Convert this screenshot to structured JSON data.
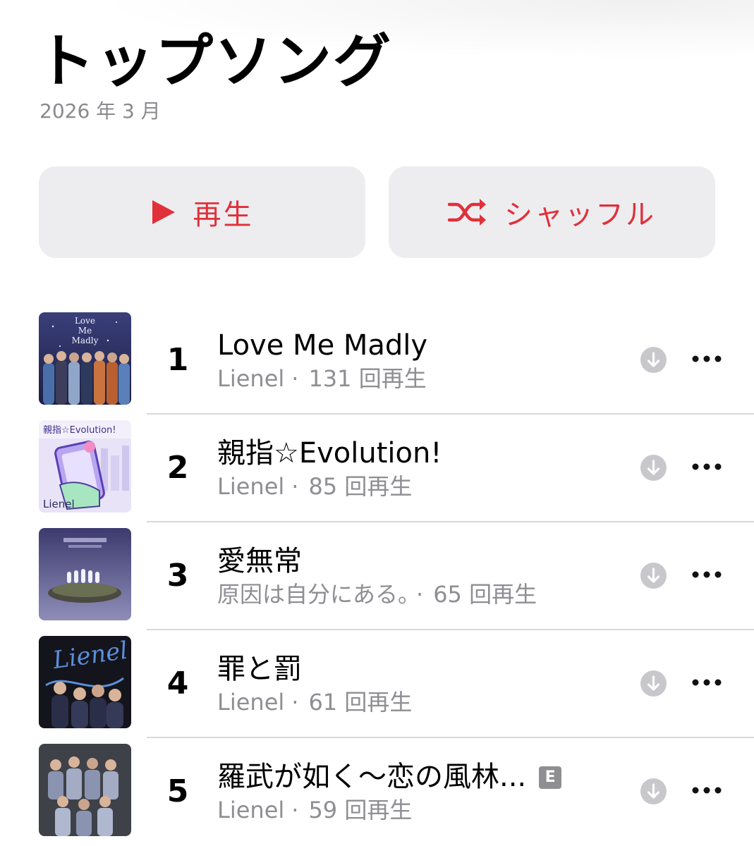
{
  "header": {
    "title": "トップソング",
    "subtitle": "2026 年 3 月"
  },
  "actions": {
    "play_label": "再生",
    "shuffle_label": "シャッフル",
    "accent_color": "#e0303a"
  },
  "songs": [
    {
      "rank": "1",
      "title": "Love Me Madly",
      "artist": "Lienel",
      "plays": "131 回再生",
      "explicit": false,
      "artwork_text": "Love Me Madly"
    },
    {
      "rank": "2",
      "title": "親指☆Evolution!",
      "artist": "Lienel",
      "plays": "85 回再生",
      "explicit": false,
      "artwork_text": "親指☆Evolution!",
      "artwork_brand": "Lienel"
    },
    {
      "rank": "3",
      "title": "愛無常",
      "artist": "原因は自分にある。",
      "plays": "65 回再生",
      "explicit": false
    },
    {
      "rank": "4",
      "title": "罪と罰",
      "artist": "Lienel",
      "plays": "61 回再生",
      "explicit": false,
      "artwork_text": "Lienel"
    },
    {
      "rank": "5",
      "title": "羅武が如く〜恋の風林...",
      "artist": "Lienel",
      "plays": "59 回再生",
      "explicit": true,
      "explicit_label": "E"
    }
  ],
  "separator": "·",
  "icons": {
    "play": "play-icon",
    "shuffle": "shuffle-icon",
    "download": "download-icon",
    "more": "more-icon"
  }
}
